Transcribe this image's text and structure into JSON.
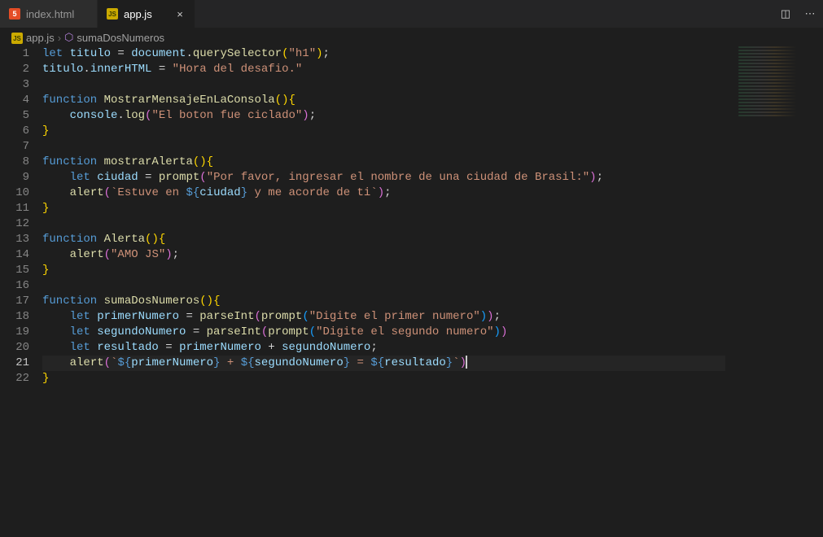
{
  "tabs": [
    {
      "label": "index.html",
      "active": false
    },
    {
      "label": "app.js",
      "active": true
    }
  ],
  "breadcrumb": {
    "file": "app.js",
    "symbol": "sumaDosNumeros"
  },
  "editor": {
    "currentLine": 21,
    "lineCount": 22
  },
  "code": {
    "lines": [
      {
        "n": 1,
        "tokens": [
          [
            "kw",
            "let "
          ],
          [
            "var",
            "titulo"
          ],
          [
            "pun",
            " = "
          ],
          [
            "var",
            "document"
          ],
          [
            "pun",
            "."
          ],
          [
            "fn",
            "querySelector"
          ],
          [
            "brk",
            "("
          ],
          [
            "str",
            "\"h1\""
          ],
          [
            "brk",
            ")"
          ],
          [
            "pun",
            ";"
          ]
        ]
      },
      {
        "n": 2,
        "tokens": [
          [
            "var",
            "titulo"
          ],
          [
            "pun",
            "."
          ],
          [
            "var",
            "innerHTML"
          ],
          [
            "pun",
            " = "
          ],
          [
            "str",
            "\"Hora del desafio.\""
          ]
        ]
      },
      {
        "n": 3,
        "tokens": []
      },
      {
        "n": 4,
        "tokens": [
          [
            "kw",
            "function "
          ],
          [
            "fn",
            "MostrarMensajeEnLaConsola"
          ],
          [
            "brk",
            "()"
          ],
          [
            "brk",
            "{"
          ]
        ]
      },
      {
        "n": 5,
        "tokens": [
          [
            "pun",
            "    "
          ],
          [
            "var",
            "console"
          ],
          [
            "pun",
            "."
          ],
          [
            "fn",
            "log"
          ],
          [
            "brk2",
            "("
          ],
          [
            "str",
            "\"El boton fue ciclado\""
          ],
          [
            "brk2",
            ")"
          ],
          [
            "pun",
            ";"
          ]
        ]
      },
      {
        "n": 6,
        "tokens": [
          [
            "brk",
            "}"
          ]
        ]
      },
      {
        "n": 7,
        "tokens": []
      },
      {
        "n": 8,
        "tokens": [
          [
            "kw",
            "function "
          ],
          [
            "fn",
            "mostrarAlerta"
          ],
          [
            "brk",
            "()"
          ],
          [
            "brk",
            "{"
          ]
        ]
      },
      {
        "n": 9,
        "tokens": [
          [
            "pun",
            "    "
          ],
          [
            "kw",
            "let "
          ],
          [
            "var",
            "ciudad"
          ],
          [
            "pun",
            " = "
          ],
          [
            "fn",
            "prompt"
          ],
          [
            "brk2",
            "("
          ],
          [
            "str",
            "\"Por favor, ingresar el nombre de una ciudad de Brasil:\""
          ],
          [
            "brk2",
            ")"
          ],
          [
            "pun",
            ";"
          ]
        ]
      },
      {
        "n": 10,
        "tokens": [
          [
            "pun",
            "    "
          ],
          [
            "fn",
            "alert"
          ],
          [
            "brk2",
            "("
          ],
          [
            "str",
            "`Estuve en "
          ],
          [
            "ti",
            "${"
          ],
          [
            "var",
            "ciudad"
          ],
          [
            "ti",
            "}"
          ],
          [
            "str",
            " y me acorde de ti`"
          ],
          [
            "brk2",
            ")"
          ],
          [
            "pun",
            ";"
          ]
        ]
      },
      {
        "n": 11,
        "tokens": [
          [
            "brk",
            "}"
          ]
        ]
      },
      {
        "n": 12,
        "tokens": []
      },
      {
        "n": 13,
        "tokens": [
          [
            "kw",
            "function "
          ],
          [
            "fn",
            "Alerta"
          ],
          [
            "brk",
            "()"
          ],
          [
            "brk",
            "{"
          ]
        ]
      },
      {
        "n": 14,
        "tokens": [
          [
            "pun",
            "    "
          ],
          [
            "fn",
            "alert"
          ],
          [
            "brk2",
            "("
          ],
          [
            "str",
            "\"AMO JS\""
          ],
          [
            "brk2",
            ")"
          ],
          [
            "pun",
            ";"
          ]
        ]
      },
      {
        "n": 15,
        "tokens": [
          [
            "brk",
            "}"
          ]
        ]
      },
      {
        "n": 16,
        "tokens": []
      },
      {
        "n": 17,
        "tokens": [
          [
            "kw",
            "function "
          ],
          [
            "fn",
            "sumaDosNumeros"
          ],
          [
            "brk",
            "()"
          ],
          [
            "brk",
            "{"
          ]
        ]
      },
      {
        "n": 18,
        "tokens": [
          [
            "pun",
            "    "
          ],
          [
            "kw",
            "let "
          ],
          [
            "var",
            "primerNumero"
          ],
          [
            "pun",
            " = "
          ],
          [
            "fn",
            "parseInt"
          ],
          [
            "brk2",
            "("
          ],
          [
            "fn",
            "prompt"
          ],
          [
            "brk3",
            "("
          ],
          [
            "str",
            "\"Digite el primer numero\""
          ],
          [
            "brk3",
            ")"
          ],
          [
            "brk2",
            ")"
          ],
          [
            "pun",
            ";"
          ]
        ]
      },
      {
        "n": 19,
        "tokens": [
          [
            "pun",
            "    "
          ],
          [
            "kw",
            "let "
          ],
          [
            "var",
            "segundoNumero"
          ],
          [
            "pun",
            " = "
          ],
          [
            "fn",
            "parseInt"
          ],
          [
            "brk2",
            "("
          ],
          [
            "fn",
            "prompt"
          ],
          [
            "brk3",
            "("
          ],
          [
            "str",
            "\"Digite el segundo numero\""
          ],
          [
            "brk3",
            ")"
          ],
          [
            "brk2",
            ")"
          ]
        ]
      },
      {
        "n": 20,
        "tokens": [
          [
            "pun",
            "    "
          ],
          [
            "kw",
            "let "
          ],
          [
            "var",
            "resultado"
          ],
          [
            "pun",
            " = "
          ],
          [
            "var",
            "primerNumero"
          ],
          [
            "pun",
            " + "
          ],
          [
            "var",
            "segundoNumero"
          ],
          [
            "pun",
            ";"
          ]
        ]
      },
      {
        "n": 21,
        "tokens": [
          [
            "pun",
            "    "
          ],
          [
            "fn",
            "alert"
          ],
          [
            "brk2",
            "("
          ],
          [
            "str",
            "`"
          ],
          [
            "ti",
            "${"
          ],
          [
            "var",
            "primerNumero"
          ],
          [
            "ti",
            "}"
          ],
          [
            "str",
            " + "
          ],
          [
            "ti",
            "${"
          ],
          [
            "var",
            "segundoNumero"
          ],
          [
            "ti",
            "}"
          ],
          [
            "str",
            " = "
          ],
          [
            "ti",
            "${"
          ],
          [
            "var",
            "resultado"
          ],
          [
            "ti",
            "}"
          ],
          [
            "str",
            "`"
          ],
          [
            "brk2",
            ")"
          ]
        ]
      },
      {
        "n": 22,
        "tokens": [
          [
            "brk",
            "}"
          ]
        ]
      }
    ]
  }
}
